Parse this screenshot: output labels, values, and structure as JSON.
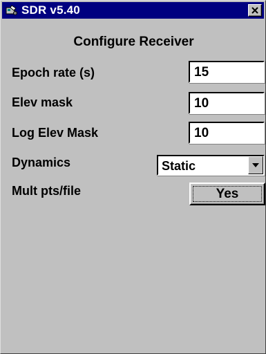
{
  "window": {
    "title": "SDR v5.40",
    "app_icon": "sdr-app-icon",
    "close_icon": "close-icon",
    "colors": {
      "titlebar": "#000080",
      "face": "#c0c0c0"
    }
  },
  "form": {
    "heading": "Configure Receiver",
    "epoch_rate": {
      "label": "Epoch rate (s)",
      "value": "15"
    },
    "elev_mask": {
      "label": "Elev mask",
      "value": "10"
    },
    "log_elev_mask": {
      "label": "Log Elev Mask",
      "value": "10"
    },
    "dynamics": {
      "label": "Dynamics",
      "value": "Static"
    },
    "mult_pts": {
      "label": "Mult pts/file",
      "value": "Yes"
    }
  }
}
